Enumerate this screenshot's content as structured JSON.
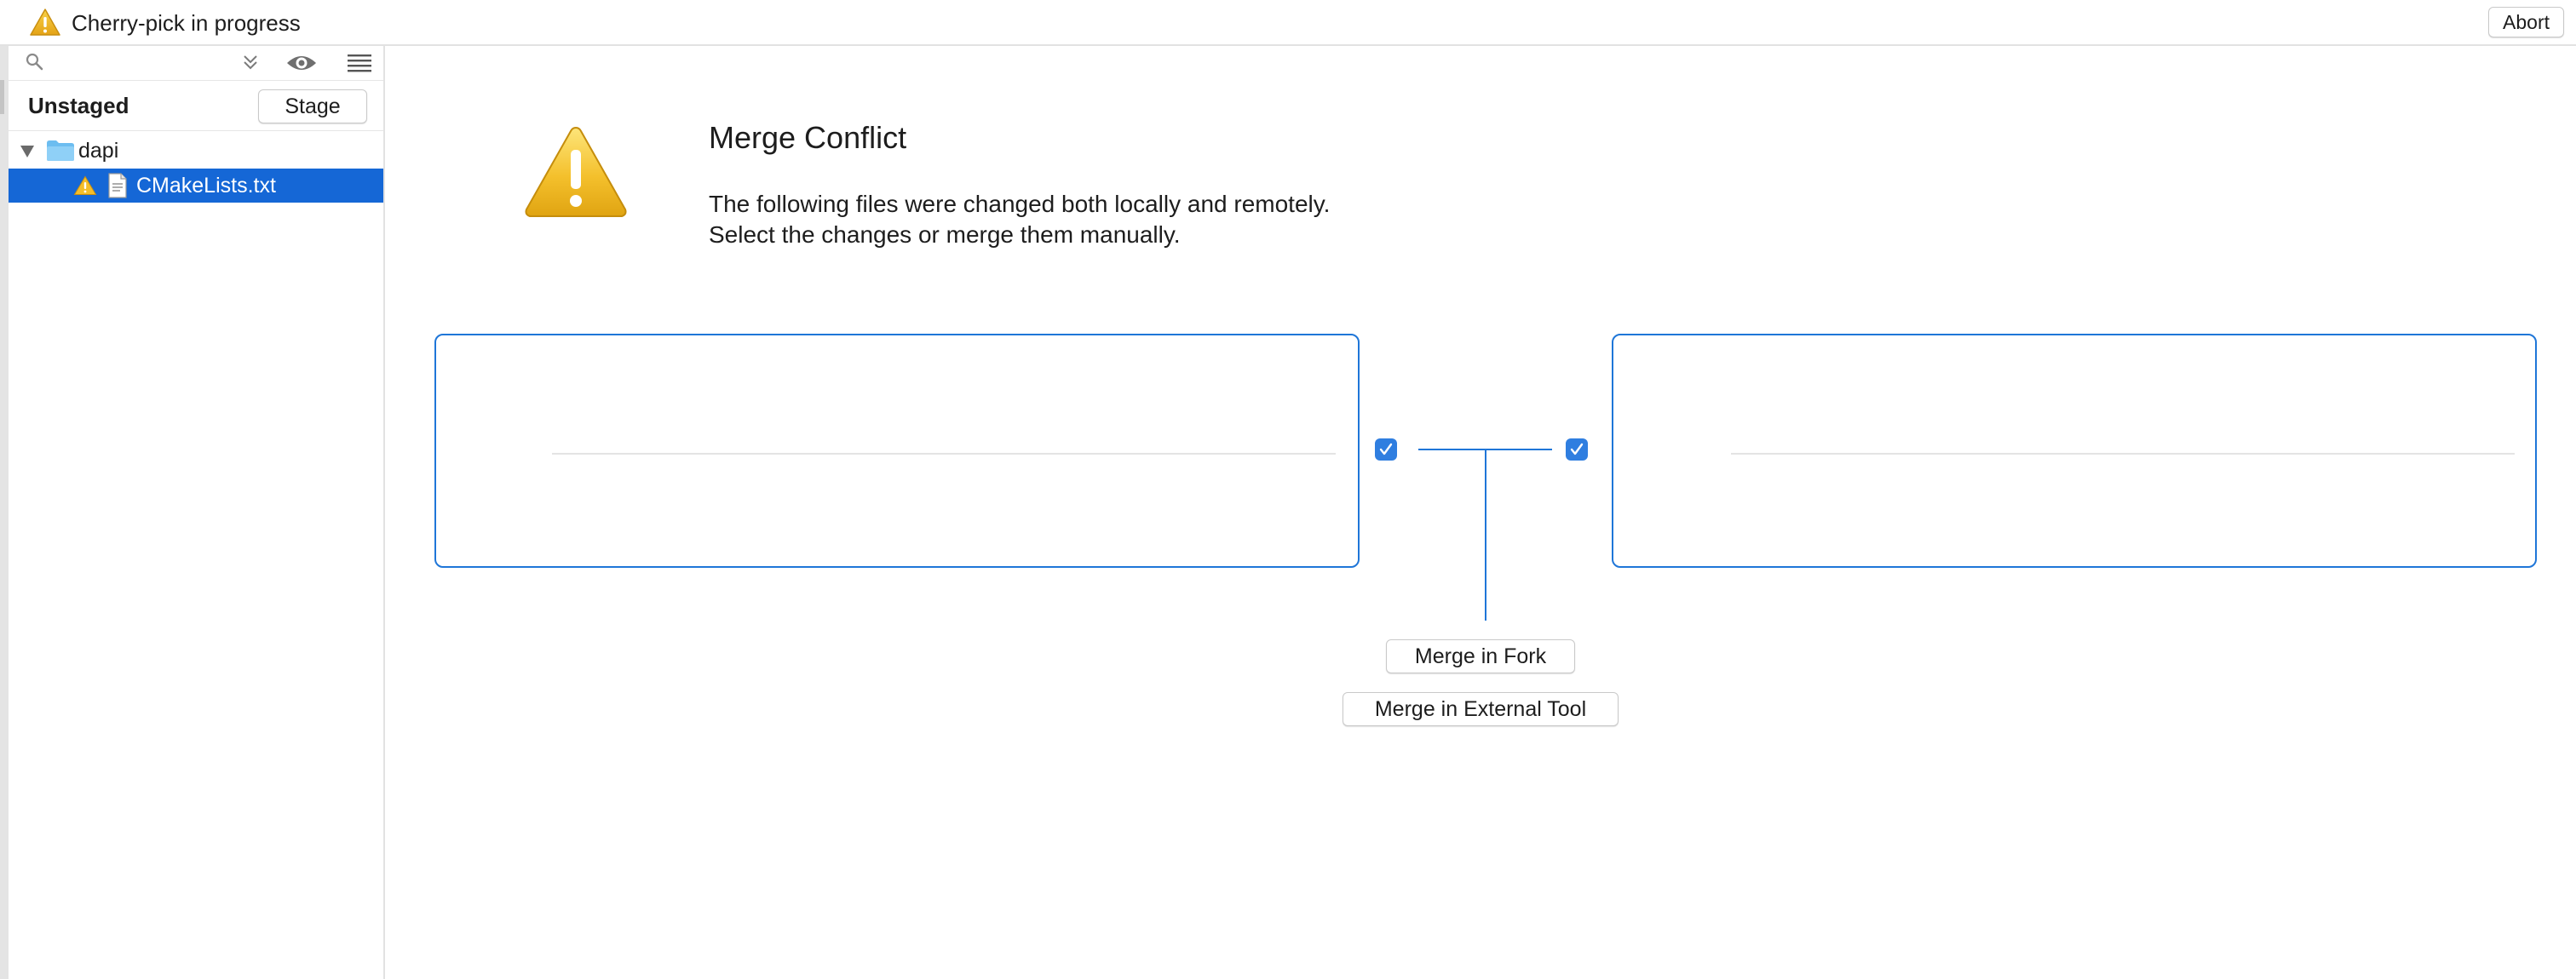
{
  "banner": {
    "title": "Cherry-pick in progress",
    "abort_label": "Abort",
    "warning_icon": "warning-triangle-icon"
  },
  "sidebar": {
    "filter": {
      "placeholder": "",
      "icons": [
        "search-icon",
        "chevron-double-down-icon",
        "eye-icon",
        "list-icon"
      ]
    },
    "section_title": "Unstaged",
    "stage_label": "Stage",
    "tree": [
      {
        "type": "folder",
        "label": "dapi",
        "expanded": true,
        "icon": "folder-icon"
      },
      {
        "type": "file",
        "label": "CMakeLists.txt",
        "selected": true,
        "status_icon": "warning-icon",
        "icon": "text-file-icon"
      }
    ]
  },
  "main": {
    "title": "Merge Conflict",
    "description_lines": [
      "The following files were changed both locally and remotely.",
      "Select the changes or merge them manually."
    ],
    "left_checked": true,
    "right_checked": true,
    "merge_in_fork_label": "Merge in Fork",
    "merge_external_label": "Merge in External Tool"
  },
  "colors": {
    "accent": "#1f76d8",
    "selection": "#1567d6",
    "warning": "#f2b31c"
  }
}
